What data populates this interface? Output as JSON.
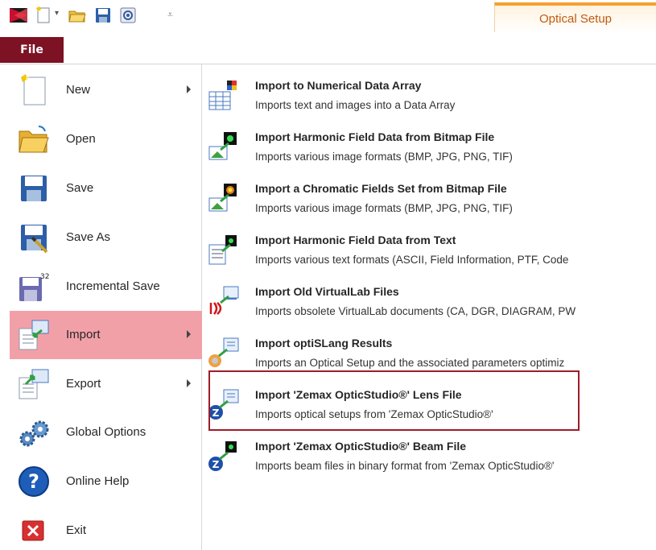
{
  "app": {
    "context_tab": "Optical Setup",
    "file_tab": "File"
  },
  "quick_access": [
    {
      "icon": "app-logo-icon"
    },
    {
      "icon": "new-document-icon"
    },
    {
      "icon": "open-folder-icon"
    },
    {
      "icon": "save-disk-icon"
    },
    {
      "icon": "settings-icon"
    }
  ],
  "left_menu": {
    "items": [
      {
        "label": "New",
        "icon": "new-document-icon",
        "has_submenu": true
      },
      {
        "label": "Open",
        "icon": "open-folder-icon",
        "has_submenu": false
      },
      {
        "label": "Save",
        "icon": "save-disk-icon",
        "has_submenu": false
      },
      {
        "label": "Save As",
        "icon": "save-as-icon",
        "has_submenu": false
      },
      {
        "label": "Incremental Save",
        "icon": "incremental-save-icon",
        "has_submenu": false
      },
      {
        "label": "Import",
        "icon": "import-icon",
        "has_submenu": true,
        "selected": true
      },
      {
        "label": "Export",
        "icon": "export-icon",
        "has_submenu": true
      },
      {
        "label": "Global Options",
        "icon": "gears-icon",
        "has_submenu": false
      },
      {
        "label": "Online Help",
        "icon": "help-icon",
        "has_submenu": false
      },
      {
        "label": "Exit",
        "icon": "exit-icon",
        "has_submenu": false
      }
    ]
  },
  "import_submenu": {
    "items": [
      {
        "title": "Import to Numerical Data Array",
        "description": "Imports text and images into a Data Array",
        "icon": "data-array-icon"
      },
      {
        "title": "Import Harmonic Field Data from Bitmap File",
        "description": "Imports various image formats (BMP, JPG, PNG, TIF)",
        "icon": "bitmap-field-icon"
      },
      {
        "title": "Import a Chromatic Fields Set from Bitmap File",
        "description": "Imports various image formats (BMP, JPG, PNG, TIF)",
        "icon": "chromatic-bitmap-icon"
      },
      {
        "title": "Import Harmonic Field Data from Text",
        "description": "Imports various text formats (ASCII, Field Information, PTF, Code",
        "icon": "text-field-icon"
      },
      {
        "title": "Import Old VirtualLab Files",
        "description": "Imports obsolete VirtualLab documents (CA, DGR, DIAGRAM, PW",
        "icon": "virtuallab-icon"
      },
      {
        "title": "Import optiSLang Results",
        "description": "Imports an Optical Setup and the associated parameters optimiz",
        "icon": "optislang-icon"
      },
      {
        "title": "Import 'Zemax OpticStudio®' Lens File",
        "description": "Imports optical setups from 'Zemax OpticStudio®'",
        "icon": "zemax-lens-icon",
        "highlighted": true
      },
      {
        "title": "Import 'Zemax OpticStudio®' Beam File",
        "description": "Imports beam files in binary format from 'Zemax OpticStudio®'",
        "icon": "zemax-beam-icon"
      }
    ]
  },
  "colors": {
    "file_tab": "#7c1224",
    "selected_item": "#f2a0a8",
    "highlight_border": "#9e1c28",
    "context_tab_text": "#c15a10",
    "context_tab_accent": "#f5a030"
  }
}
